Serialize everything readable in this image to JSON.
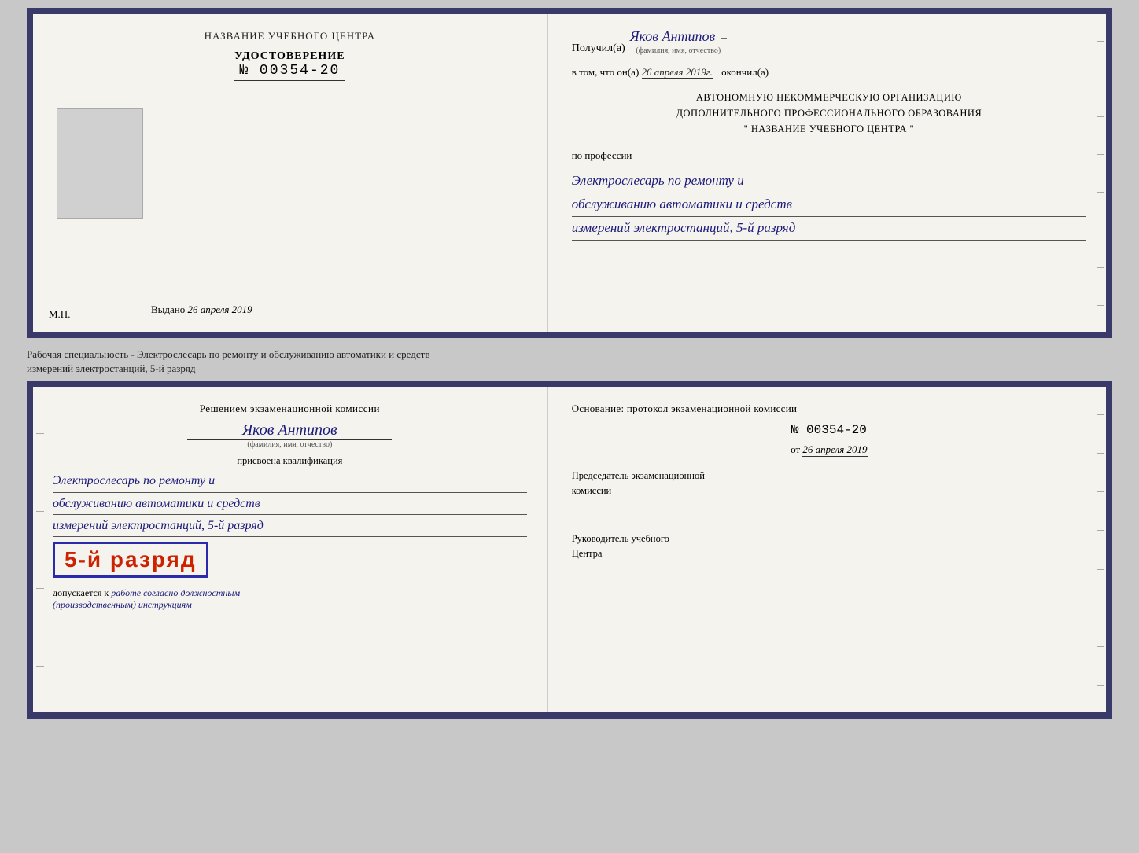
{
  "top_doc": {
    "left": {
      "center_title": "НАЗВАНИЕ УЧЕБНОГО ЦЕНТРА",
      "photo_alt": "photo",
      "udost_label": "УДОСТОВЕРЕНИЕ",
      "udost_num": "№ 00354-20",
      "vudano_label": "Выдано",
      "vudano_date": "26 апреля 2019",
      "mp_label": "М.П."
    },
    "right": {
      "poluchil_label": "Получил(а)",
      "recipient_name": "Яков Антипов",
      "fio_subtitle": "(фамилия, имя, отчество)",
      "dash": "–",
      "vtom_label": "в том, что он(а)",
      "vtom_date": "26 апреля 2019г.",
      "okonchil": "окончил(а)",
      "org_line1": "АВТОНОМНУЮ НЕКОММЕРЧЕСКУЮ ОРГАНИЗАЦИЮ",
      "org_line2": "ДОПОЛНИТЕЛЬНОГО ПРОФЕССИОНАЛЬНОГО ОБРАЗОВАНИЯ",
      "org_line3": "\"    НАЗВАНИЕ УЧЕБНОГО ЦЕНТРА    \"",
      "poprofessii": "по профессии",
      "profession_line1": "Электрослесарь по ремонту и",
      "profession_line2": "обслуживанию автоматики и средств",
      "profession_line3": "измерений электростанций, 5-й разряд"
    }
  },
  "between_label": {
    "line1": "Рабочая специальность - Электрослесарь по ремонту и обслуживанию автоматики и средств",
    "line2": "измерений электростанций, 5-й разряд"
  },
  "bottom_doc": {
    "left": {
      "reshenie_title": "Решением экзаменационной комиссии",
      "name": "Яков Антипов",
      "fio_subtitle": "(фамилия, имя, отчество)",
      "prisvoena": "присвоена квалификация",
      "qual_line1": "Электрослесарь по ремонту и",
      "qual_line2": "обслуживанию автоматики и средств",
      "qual_line3": "измерений электростанций, 5-й разряд",
      "razryad_text": "5-й разряд",
      "dopuskaetsya_prefix": "допускается к",
      "dopuskaetsya_text": "работе согласно должностным",
      "dopuskaetsya_text2": "(производственным) инструкциям"
    },
    "right": {
      "osnovanie_title": "Основание: протокол экзаменационной  комиссии",
      "protocol_num": "№  00354-20",
      "ot_prefix": "от",
      "ot_date": "26 апреля 2019",
      "chair_title_line1": "Председатель экзаменационной",
      "chair_title_line2": "комиссии",
      "ruk_title_line1": "Руководитель учебного",
      "ruk_title_line2": "Центра"
    }
  }
}
